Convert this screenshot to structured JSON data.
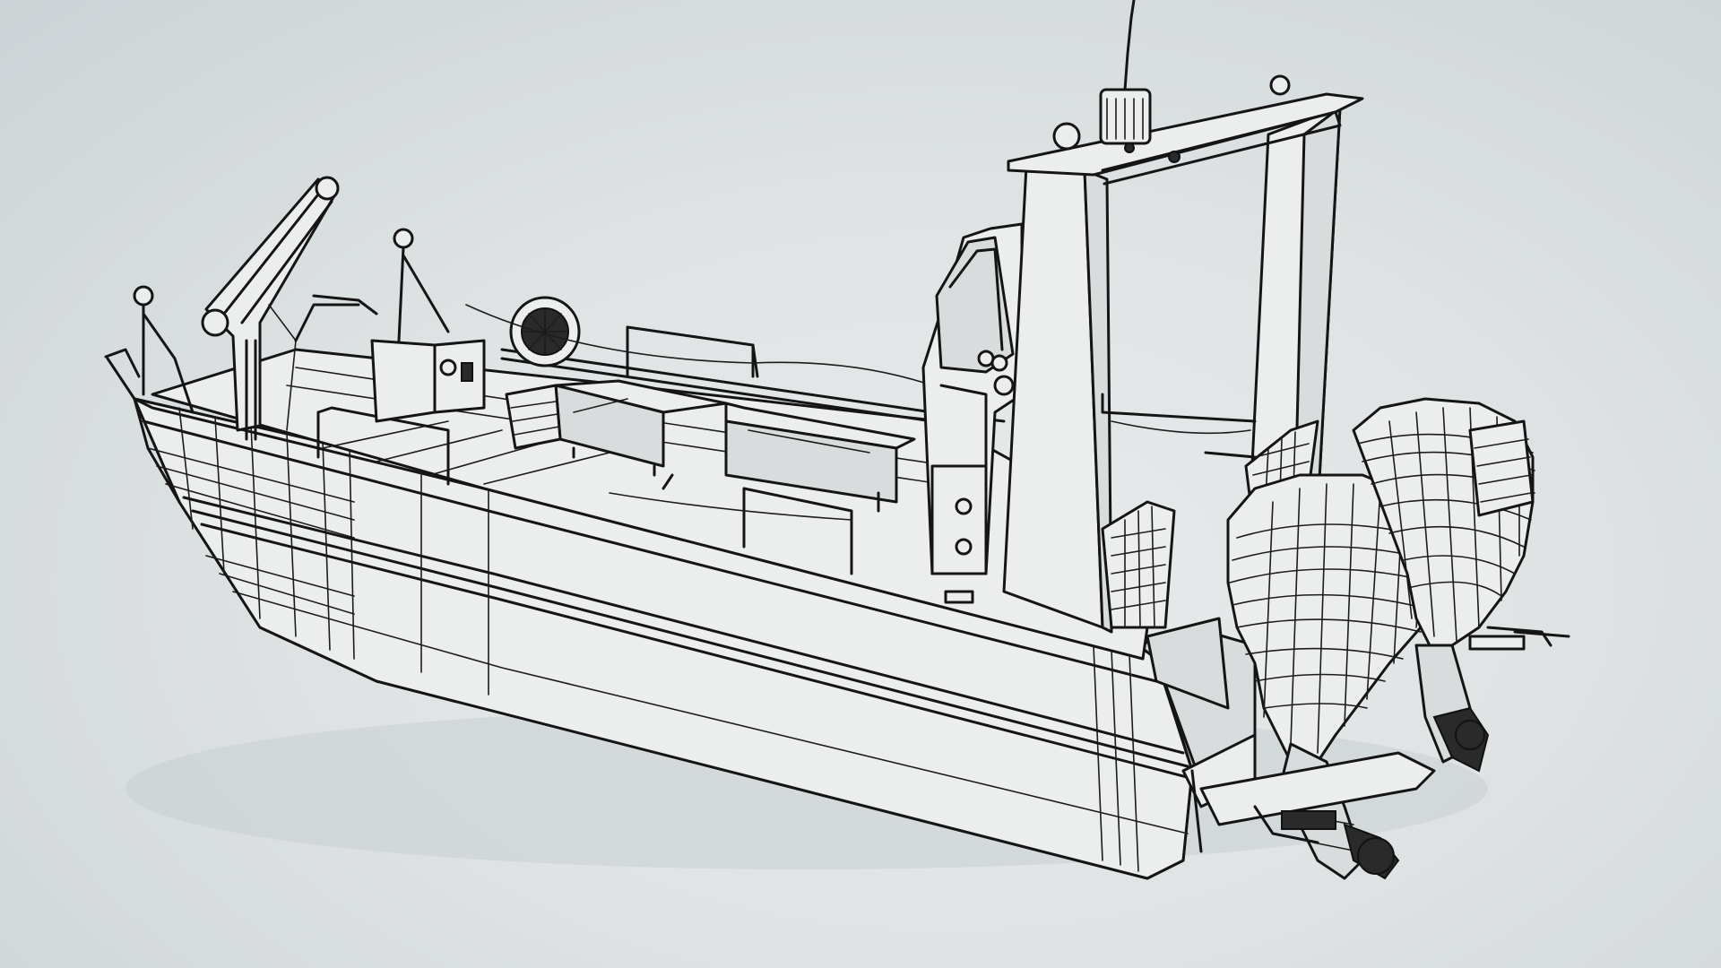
{
  "scene": {
    "subject": "wireframe-boat-render",
    "colors": {
      "background": "#dfe3e4",
      "surface": "#eceeee",
      "surface_shadow": "#d9dcdd",
      "wire": "#151515"
    }
  }
}
